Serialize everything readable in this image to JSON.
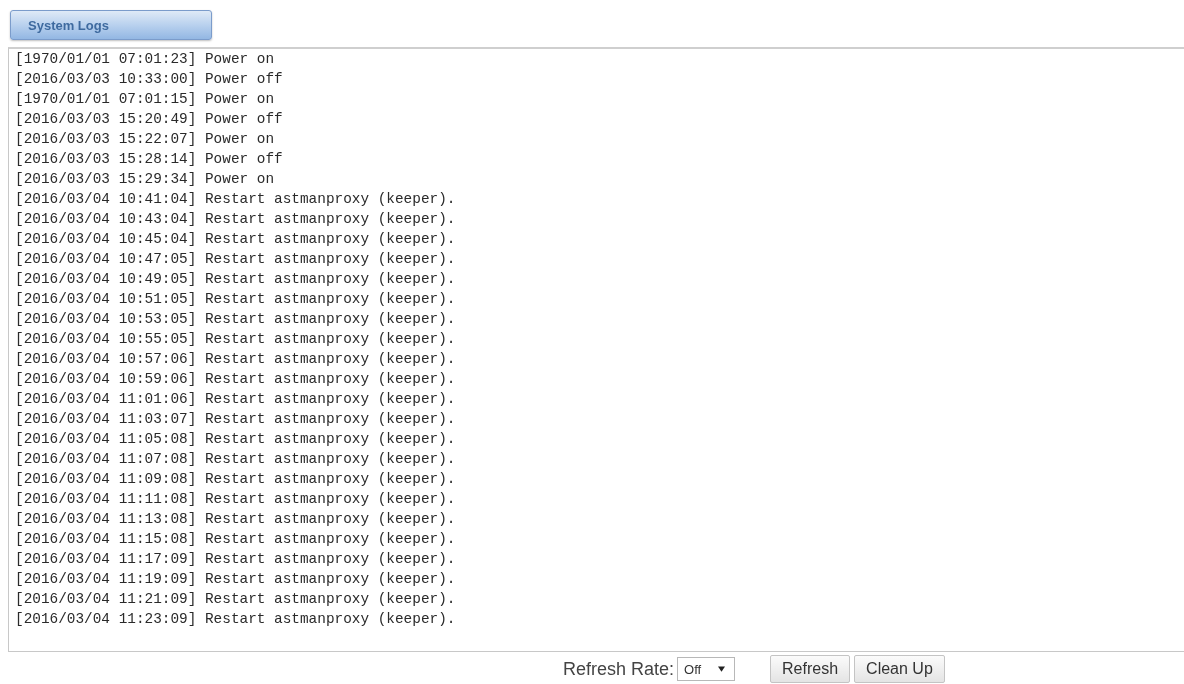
{
  "tabs": [
    {
      "label": "System Logs",
      "selected": true
    }
  ],
  "log_lines": [
    "[1970/01/01 07:01:23] Power on",
    "[2016/03/03 10:33:00] Power off",
    "[1970/01/01 07:01:15] Power on",
    "[2016/03/03 15:20:49] Power off",
    "[2016/03/03 15:22:07] Power on",
    "[2016/03/03 15:28:14] Power off",
    "[2016/03/03 15:29:34] Power on",
    "[2016/03/04 10:41:04] Restart astmanproxy (keeper).",
    "[2016/03/04 10:43:04] Restart astmanproxy (keeper).",
    "[2016/03/04 10:45:04] Restart astmanproxy (keeper).",
    "[2016/03/04 10:47:05] Restart astmanproxy (keeper).",
    "[2016/03/04 10:49:05] Restart astmanproxy (keeper).",
    "[2016/03/04 10:51:05] Restart astmanproxy (keeper).",
    "[2016/03/04 10:53:05] Restart astmanproxy (keeper).",
    "[2016/03/04 10:55:05] Restart astmanproxy (keeper).",
    "[2016/03/04 10:57:06] Restart astmanproxy (keeper).",
    "[2016/03/04 10:59:06] Restart astmanproxy (keeper).",
    "[2016/03/04 11:01:06] Restart astmanproxy (keeper).",
    "[2016/03/04 11:03:07] Restart astmanproxy (keeper).",
    "[2016/03/04 11:05:08] Restart astmanproxy (keeper).",
    "[2016/03/04 11:07:08] Restart astmanproxy (keeper).",
    "[2016/03/04 11:09:08] Restart astmanproxy (keeper).",
    "[2016/03/04 11:11:08] Restart astmanproxy (keeper).",
    "[2016/03/04 11:13:08] Restart astmanproxy (keeper).",
    "[2016/03/04 11:15:08] Restart astmanproxy (keeper).",
    "[2016/03/04 11:17:09] Restart astmanproxy (keeper).",
    "[2016/03/04 11:19:09] Restart astmanproxy (keeper).",
    "[2016/03/04 11:21:09] Restart astmanproxy (keeper).",
    "[2016/03/04 11:23:09] Restart astmanproxy (keeper)."
  ],
  "refresh_rate": {
    "label": "Refresh Rate:",
    "value": "Off"
  },
  "buttons": [
    "Refresh",
    "Clean Up"
  ]
}
